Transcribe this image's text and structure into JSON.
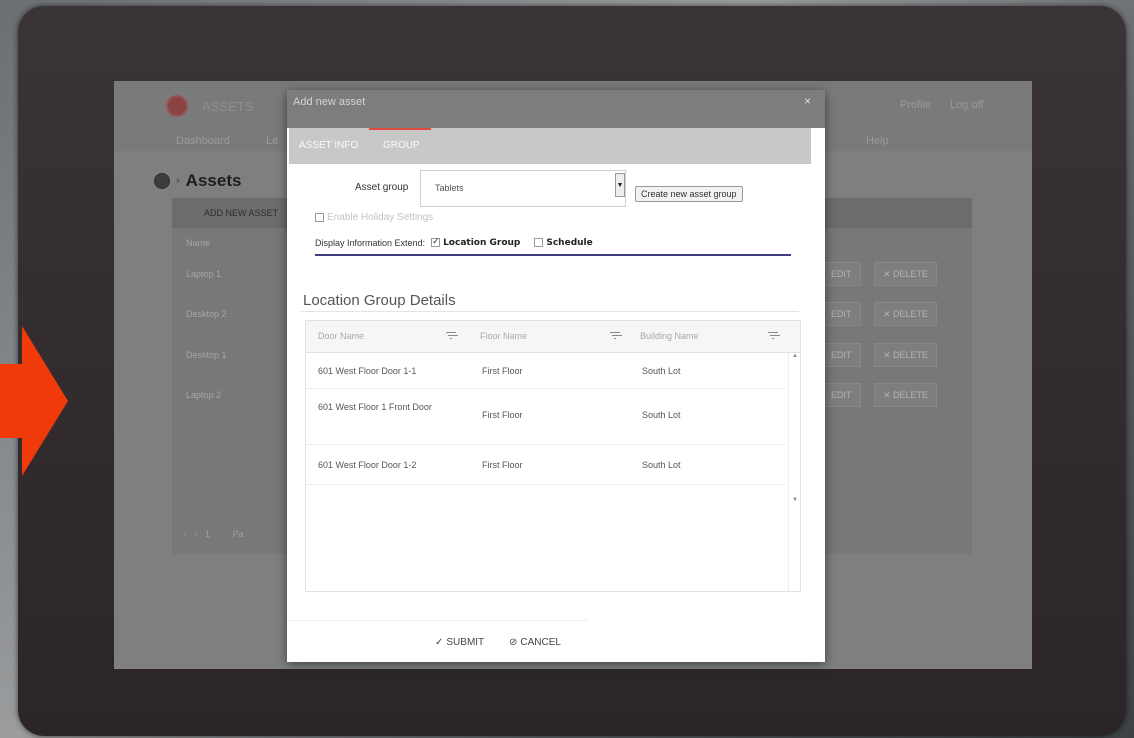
{
  "screen": {
    "app_title": "ASSETS",
    "nav": [
      "Dashboard",
      "Le",
      "Help"
    ],
    "header_links": [
      "Profile",
      "Log off"
    ],
    "page_title": "Assets",
    "toolbar": {
      "add_new_asset": "ADD NEW ASSET"
    },
    "table_header_name": "Name",
    "rows": [
      {
        "name": "Laptop 1",
        "edit": "EDIT",
        "delete": "✕ DELETE"
      },
      {
        "name": "Desktop 2",
        "edit": "EDIT",
        "delete": "✕ DELETE"
      },
      {
        "name": "Desktop 1",
        "edit": "EDIT",
        "delete": "✕ DELETE"
      },
      {
        "name": "Laptop 2",
        "edit": "EDIT",
        "delete": "✕ DELETE"
      }
    ],
    "pager": {
      "page": "1",
      "label": "Pa"
    }
  },
  "modal": {
    "title": "Add new asset",
    "close": "×",
    "tabs": [
      {
        "label": "ASSET INFO",
        "active": false
      },
      {
        "label": "GROUP",
        "active": true
      }
    ],
    "asset_group_label": "Asset group",
    "asset_group_value": "Tablets",
    "create_group_button": "Create new asset group",
    "holiday_label": "Enable Holiday Settings",
    "display_label": "Display Information Extend:",
    "location_group_option": "Location Group",
    "schedule_option": "Schedule",
    "section_title": "Location Group Details",
    "grid": {
      "columns": [
        "Door Name",
        "Floor Name",
        "Building Name"
      ],
      "rows": [
        [
          "601 West Floor Door 1-1",
          "First Floor",
          "South Lot"
        ],
        [
          "601 West Floor 1 Front Door",
          "First Floor",
          "South Lot"
        ],
        [
          "601 West Floor Door 1-2",
          "First Floor",
          "South Lot"
        ]
      ]
    },
    "submit": "SUBMIT",
    "cancel": "CANCEL"
  },
  "colors": {
    "arrow": "#f13a0a",
    "active_tab_underline": "#e04a3a",
    "divider_blue": "#3f3d80"
  }
}
